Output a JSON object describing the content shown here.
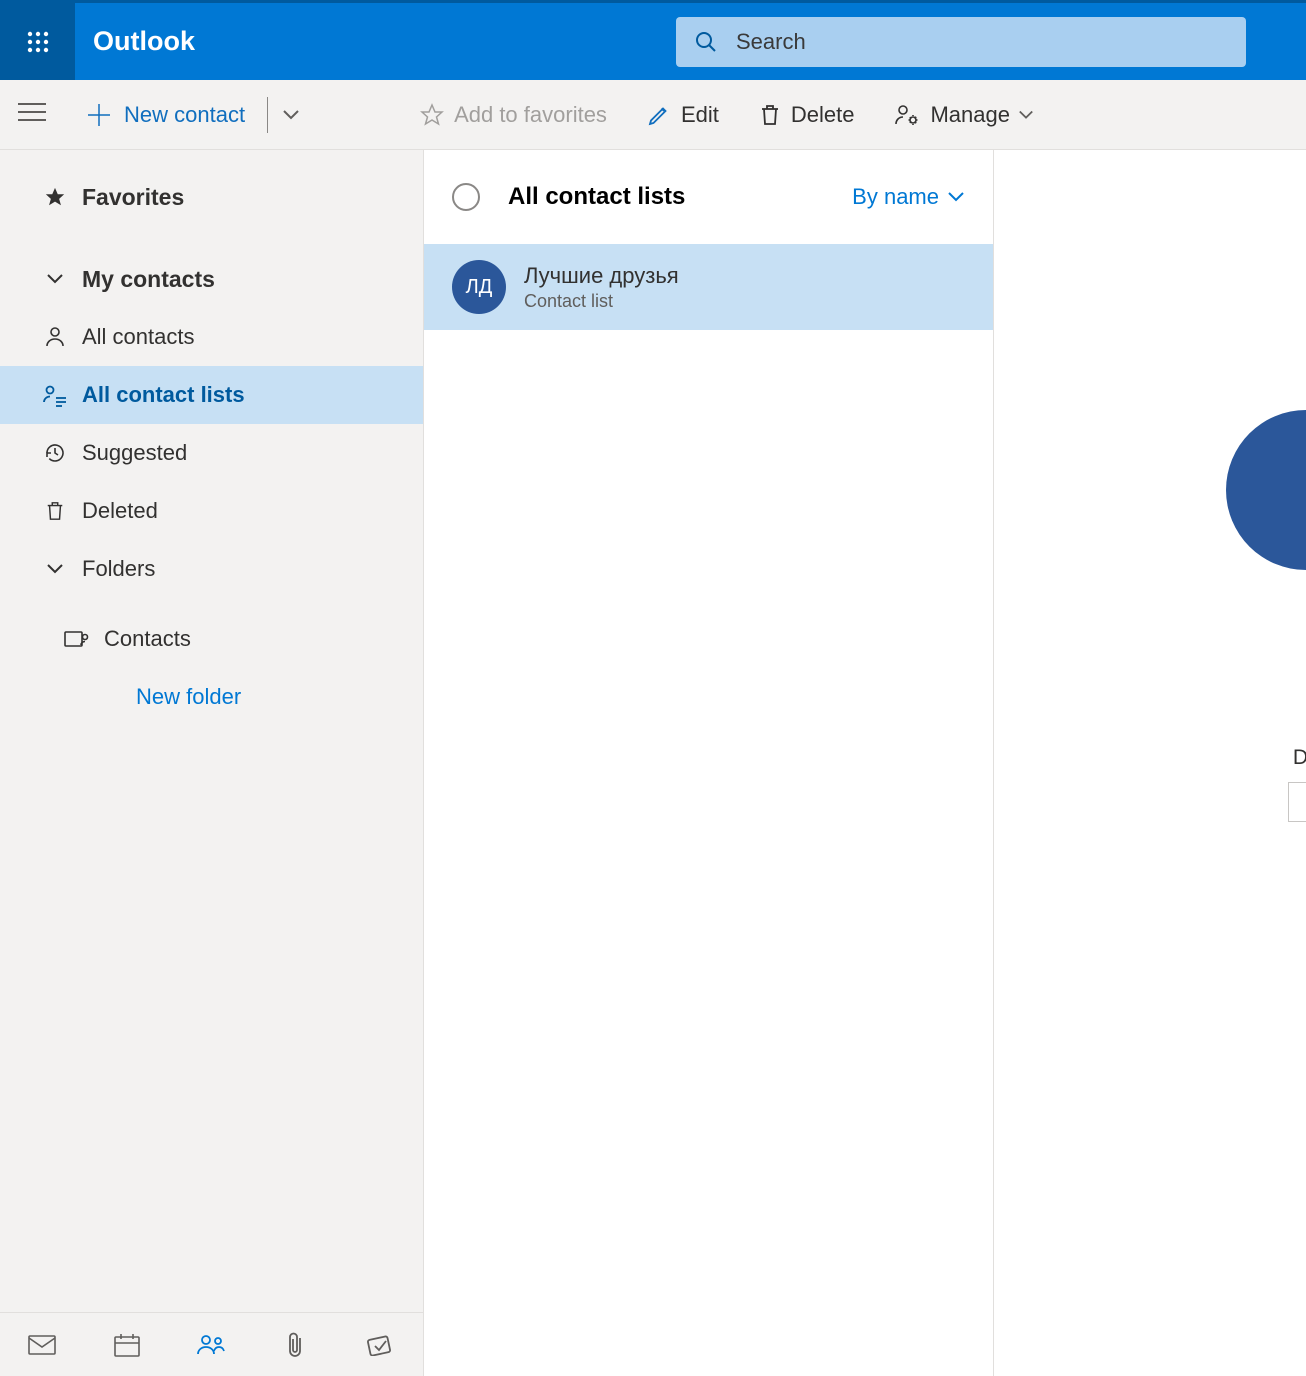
{
  "header": {
    "brand": "Outlook",
    "search_placeholder": "Search"
  },
  "cmdbar": {
    "new_contact": "New contact",
    "add_to_favorites": "Add to favorites",
    "edit": "Edit",
    "delete": "Delete",
    "manage": "Manage"
  },
  "sidebar": {
    "favorites": "Favorites",
    "my_contacts": "My contacts",
    "all_contacts": "All contacts",
    "all_contact_lists": "All contact lists",
    "suggested": "Suggested",
    "deleted": "Deleted",
    "folders": "Folders",
    "contacts": "Contacts",
    "new_folder": "New folder"
  },
  "list": {
    "title": "All contact lists",
    "sort": "By name",
    "items": [
      {
        "initials": "ЛД",
        "name": "Лучшие друзья",
        "subtitle": "Contact list"
      }
    ]
  },
  "detail": {
    "field_label_clip": "D"
  }
}
